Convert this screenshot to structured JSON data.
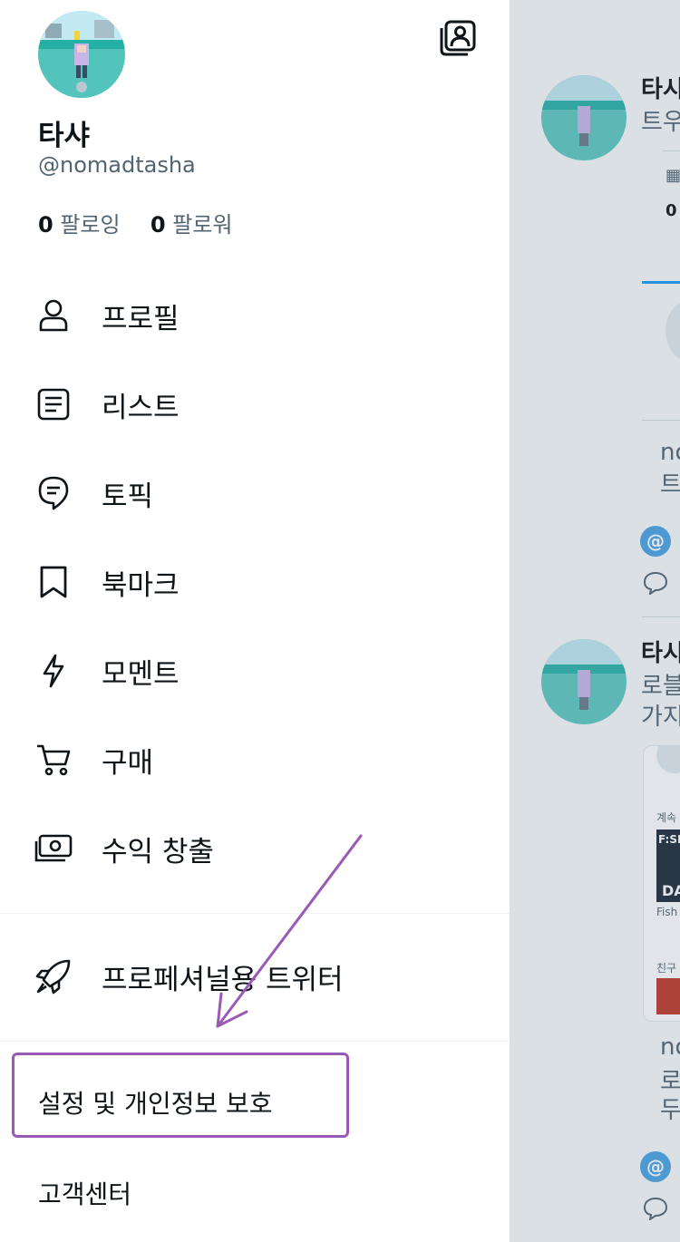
{
  "profile": {
    "display_name": "타샤",
    "handle": "@nomadtasha",
    "following_count": "0",
    "following_label": "팔로잉",
    "followers_count": "0",
    "followers_label": "팔로워"
  },
  "menu": {
    "items": [
      {
        "label": "프로필",
        "icon": "person-icon"
      },
      {
        "label": "리스트",
        "icon": "list-icon"
      },
      {
        "label": "토픽",
        "icon": "topic-icon"
      },
      {
        "label": "북마크",
        "icon": "bookmark-icon"
      },
      {
        "label": "모멘트",
        "icon": "lightning-icon"
      },
      {
        "label": "구매",
        "icon": "cart-icon"
      },
      {
        "label": "수익 창출",
        "icon": "money-icon"
      }
    ],
    "professional": {
      "label": "프로페셔널용 트위터",
      "icon": "rocket-icon"
    },
    "settings_label": "설정 및 개인정보 보호",
    "help_label": "고객센터"
  },
  "annotation": {
    "color": "#9b59b6"
  },
  "feed": {
    "post1_name": "타시",
    "post1_text": "트우",
    "post1_count": "0",
    "partial1": "no",
    "partial2": "트",
    "post2_name": "타시",
    "post2_line1": "로블",
    "post2_line2": "가지",
    "card_label1": "계속",
    "card_label2": "F:SH",
    "card_label3": "DA",
    "card_label4": "Fish",
    "card_label5": "친구",
    "partial3": "no",
    "partial4": "로",
    "partial5": "두",
    "mention_glyph": "@"
  }
}
